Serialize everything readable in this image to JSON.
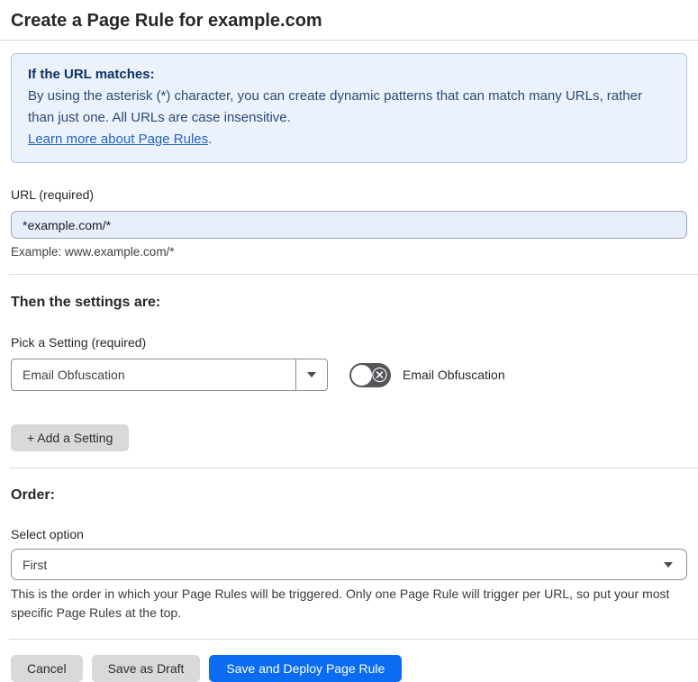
{
  "page": {
    "title": "Create a Page Rule for example.com"
  },
  "info_box": {
    "heading": "If the URL matches:",
    "body": "By using the asterisk (*) character, you can create dynamic patterns that can match many URLs, rather than just one. All URLs are case insensitive.",
    "link_label": "Learn more about Page Rules",
    "link_suffix": "."
  },
  "url_section": {
    "label": "URL (required)",
    "input_value": "*example.com/*",
    "helper": "Example: www.example.com/*"
  },
  "settings_section": {
    "heading": "Then the settings are:",
    "pick_label": "Pick a Setting (required)",
    "selected_setting": "Email Obfuscation",
    "toggle_label": "Email Obfuscation",
    "toggle_state": "off",
    "add_button_label": "+ Add a Setting"
  },
  "order_section": {
    "heading": "Order:",
    "select_label": "Select option",
    "selected_option": "First",
    "helper": "This is the order in which your Page Rules will be triggered. Only one Page Rule will trigger per URL, so put your most specific Page Rules at the top."
  },
  "footer": {
    "cancel_label": "Cancel",
    "save_draft_label": "Save as Draft",
    "save_deploy_label": "Save and Deploy Page Rule"
  },
  "icons": {
    "caret_down": "caret-down-icon",
    "toggle_off_x": "x-circle-icon"
  },
  "colors": {
    "primary_blue": "#0b6cf2",
    "info_bg": "#ebf2fb",
    "info_border": "#abc8e8",
    "info_heading_text": "#0d3464",
    "info_body_text": "#2d4a77",
    "link_blue": "#2563c7",
    "input_bg": "#e7edfb",
    "gray_button_bg": "#d9d9d9",
    "toggle_off_bg": "#55565a",
    "divider": "#d9d9d9"
  }
}
